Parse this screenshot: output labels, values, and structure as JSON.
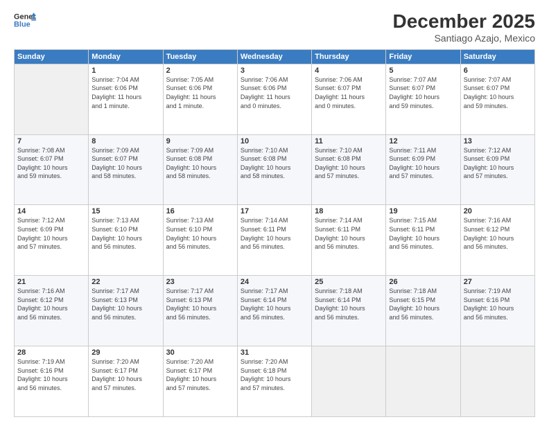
{
  "header": {
    "logo_line1": "General",
    "logo_line2": "Blue",
    "title": "December 2025",
    "subtitle": "Santiago Azajo, Mexico"
  },
  "days_of_week": [
    "Sunday",
    "Monday",
    "Tuesday",
    "Wednesday",
    "Thursday",
    "Friday",
    "Saturday"
  ],
  "weeks": [
    [
      {
        "num": "",
        "info": ""
      },
      {
        "num": "1",
        "info": "Sunrise: 7:04 AM\nSunset: 6:06 PM\nDaylight: 11 hours\nand 1 minute."
      },
      {
        "num": "2",
        "info": "Sunrise: 7:05 AM\nSunset: 6:06 PM\nDaylight: 11 hours\nand 1 minute."
      },
      {
        "num": "3",
        "info": "Sunrise: 7:06 AM\nSunset: 6:06 PM\nDaylight: 11 hours\nand 0 minutes."
      },
      {
        "num": "4",
        "info": "Sunrise: 7:06 AM\nSunset: 6:07 PM\nDaylight: 11 hours\nand 0 minutes."
      },
      {
        "num": "5",
        "info": "Sunrise: 7:07 AM\nSunset: 6:07 PM\nDaylight: 10 hours\nand 59 minutes."
      },
      {
        "num": "6",
        "info": "Sunrise: 7:07 AM\nSunset: 6:07 PM\nDaylight: 10 hours\nand 59 minutes."
      }
    ],
    [
      {
        "num": "7",
        "info": "Sunrise: 7:08 AM\nSunset: 6:07 PM\nDaylight: 10 hours\nand 59 minutes."
      },
      {
        "num": "8",
        "info": "Sunrise: 7:09 AM\nSunset: 6:07 PM\nDaylight: 10 hours\nand 58 minutes."
      },
      {
        "num": "9",
        "info": "Sunrise: 7:09 AM\nSunset: 6:08 PM\nDaylight: 10 hours\nand 58 minutes."
      },
      {
        "num": "10",
        "info": "Sunrise: 7:10 AM\nSunset: 6:08 PM\nDaylight: 10 hours\nand 58 minutes."
      },
      {
        "num": "11",
        "info": "Sunrise: 7:10 AM\nSunset: 6:08 PM\nDaylight: 10 hours\nand 57 minutes."
      },
      {
        "num": "12",
        "info": "Sunrise: 7:11 AM\nSunset: 6:09 PM\nDaylight: 10 hours\nand 57 minutes."
      },
      {
        "num": "13",
        "info": "Sunrise: 7:12 AM\nSunset: 6:09 PM\nDaylight: 10 hours\nand 57 minutes."
      }
    ],
    [
      {
        "num": "14",
        "info": "Sunrise: 7:12 AM\nSunset: 6:09 PM\nDaylight: 10 hours\nand 57 minutes."
      },
      {
        "num": "15",
        "info": "Sunrise: 7:13 AM\nSunset: 6:10 PM\nDaylight: 10 hours\nand 56 minutes."
      },
      {
        "num": "16",
        "info": "Sunrise: 7:13 AM\nSunset: 6:10 PM\nDaylight: 10 hours\nand 56 minutes."
      },
      {
        "num": "17",
        "info": "Sunrise: 7:14 AM\nSunset: 6:11 PM\nDaylight: 10 hours\nand 56 minutes."
      },
      {
        "num": "18",
        "info": "Sunrise: 7:14 AM\nSunset: 6:11 PM\nDaylight: 10 hours\nand 56 minutes."
      },
      {
        "num": "19",
        "info": "Sunrise: 7:15 AM\nSunset: 6:11 PM\nDaylight: 10 hours\nand 56 minutes."
      },
      {
        "num": "20",
        "info": "Sunrise: 7:16 AM\nSunset: 6:12 PM\nDaylight: 10 hours\nand 56 minutes."
      }
    ],
    [
      {
        "num": "21",
        "info": "Sunrise: 7:16 AM\nSunset: 6:12 PM\nDaylight: 10 hours\nand 56 minutes."
      },
      {
        "num": "22",
        "info": "Sunrise: 7:17 AM\nSunset: 6:13 PM\nDaylight: 10 hours\nand 56 minutes."
      },
      {
        "num": "23",
        "info": "Sunrise: 7:17 AM\nSunset: 6:13 PM\nDaylight: 10 hours\nand 56 minutes."
      },
      {
        "num": "24",
        "info": "Sunrise: 7:17 AM\nSunset: 6:14 PM\nDaylight: 10 hours\nand 56 minutes."
      },
      {
        "num": "25",
        "info": "Sunrise: 7:18 AM\nSunset: 6:14 PM\nDaylight: 10 hours\nand 56 minutes."
      },
      {
        "num": "26",
        "info": "Sunrise: 7:18 AM\nSunset: 6:15 PM\nDaylight: 10 hours\nand 56 minutes."
      },
      {
        "num": "27",
        "info": "Sunrise: 7:19 AM\nSunset: 6:16 PM\nDaylight: 10 hours\nand 56 minutes."
      }
    ],
    [
      {
        "num": "28",
        "info": "Sunrise: 7:19 AM\nSunset: 6:16 PM\nDaylight: 10 hours\nand 56 minutes."
      },
      {
        "num": "29",
        "info": "Sunrise: 7:20 AM\nSunset: 6:17 PM\nDaylight: 10 hours\nand 57 minutes."
      },
      {
        "num": "30",
        "info": "Sunrise: 7:20 AM\nSunset: 6:17 PM\nDaylight: 10 hours\nand 57 minutes."
      },
      {
        "num": "31",
        "info": "Sunrise: 7:20 AM\nSunset: 6:18 PM\nDaylight: 10 hours\nand 57 minutes."
      },
      {
        "num": "",
        "info": ""
      },
      {
        "num": "",
        "info": ""
      },
      {
        "num": "",
        "info": ""
      }
    ]
  ]
}
